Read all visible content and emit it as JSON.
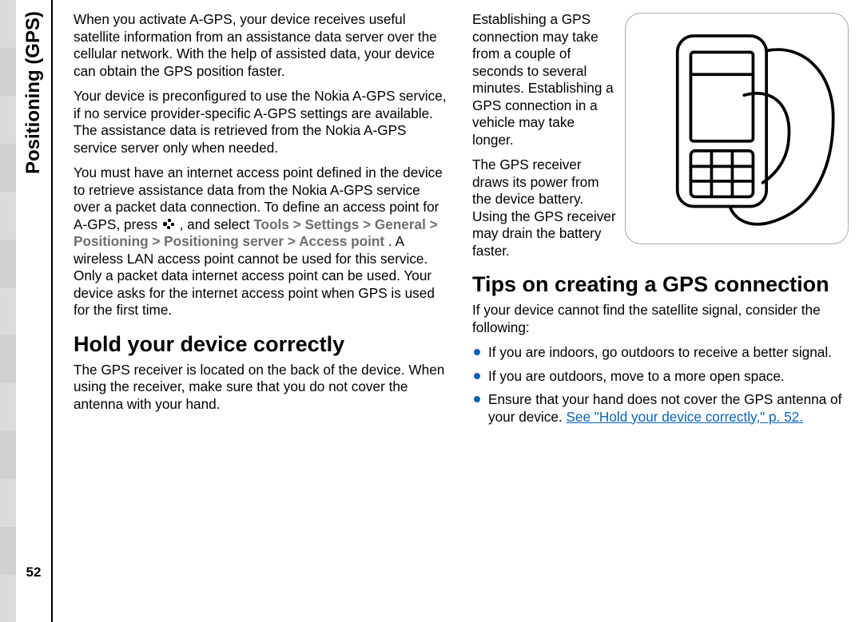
{
  "side_tab": "Positioning (GPS)",
  "page_number": "52",
  "left": {
    "p1": "When you activate A-GPS, your device receives useful satellite information from an assistance data server over the cellular network. With the help of assisted data, your device can obtain the GPS position faster.",
    "p2": "Your device is preconfigured to use the Nokia A-GPS service, if no service provider-specific A-GPS settings are available. The assistance data is retrieved from the Nokia A-GPS service server only when needed.",
    "p3a": "You must have an internet access point defined in the device to retrieve assistance data from the Nokia A-GPS service over a packet data connection. To define an access point for A-GPS, press ",
    "p3b": " , and select ",
    "path_tools": "Tools",
    "gt": " > ",
    "path_settings": "Settings",
    "path_general": "General",
    "path_positioning": "Positioning",
    "path_posserver": "Positioning server",
    "path_ap": "Access point",
    "p3c": ". A wireless LAN access point cannot be used for this service. Only a packet data internet access point can be used. Your device asks for the internet access point when GPS is used for the first time.",
    "h1": "Hold your device correctly",
    "p4": "The GPS receiver is located on the back of the device. When using the receiver, make sure that you do not cover the antenna with your hand."
  },
  "right": {
    "p5": "Establishing a GPS connection may take from a couple of seconds to several minutes. Establishing a GPS connection in a vehicle may take longer.",
    "p6": "The GPS receiver draws its power from the device battery. Using the GPS receiver may drain the battery faster.",
    "h2": "Tips on creating a GPS connection",
    "p7": "If your device cannot find the satellite signal, consider the following:",
    "b1": "If you are indoors, go outdoors to receive a better signal.",
    "b2": "If you are outdoors, move to a more open space.",
    "b3a": "Ensure that your hand does not cover the GPS antenna of your device. ",
    "b3link": "See \"Hold your device correctly,\" p. 52."
  },
  "icons": {
    "menu_key": "menu-key-icon",
    "phone_image": "phone-in-hand-illustration"
  }
}
